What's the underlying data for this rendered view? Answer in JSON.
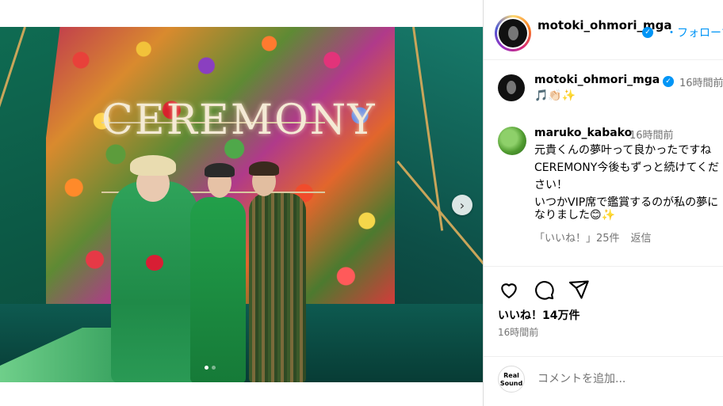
{
  "post": {
    "author": "motoki_ohmori_mga",
    "follow_label": "・フォローする",
    "banner_text": "CEREMONY",
    "carousel_count": 2,
    "carousel_active_index": 0
  },
  "caption": {
    "username": "motoki_ohmori_mga",
    "time": "16時間前",
    "text": "🎵👏🏻✨"
  },
  "comment": {
    "username": "maruko_kabako",
    "time": "16時間前",
    "lines": [
      "元貴くんの夢叶って良かったですね",
      "CEREMONY今後もずっと続けてくだ",
      "さい！",
      "いつかVIP席で鑑賞するのが私の夢に",
      "なりました😊✨"
    ],
    "likes_label": "「いいね！」25件",
    "reply_label": "返信"
  },
  "actions": {
    "like_icon": "heart-icon",
    "comment_icon": "comment-bubble-icon",
    "share_icon": "paper-plane-icon"
  },
  "likes_count": "いいね！14万件",
  "post_time": "16時間前",
  "add_comment": {
    "placeholder": "コメントを追加...",
    "realsound_label": "Real Sound"
  },
  "colors": {
    "verified": "#0095f6",
    "link": "#0095f6",
    "muted": "#737373"
  }
}
